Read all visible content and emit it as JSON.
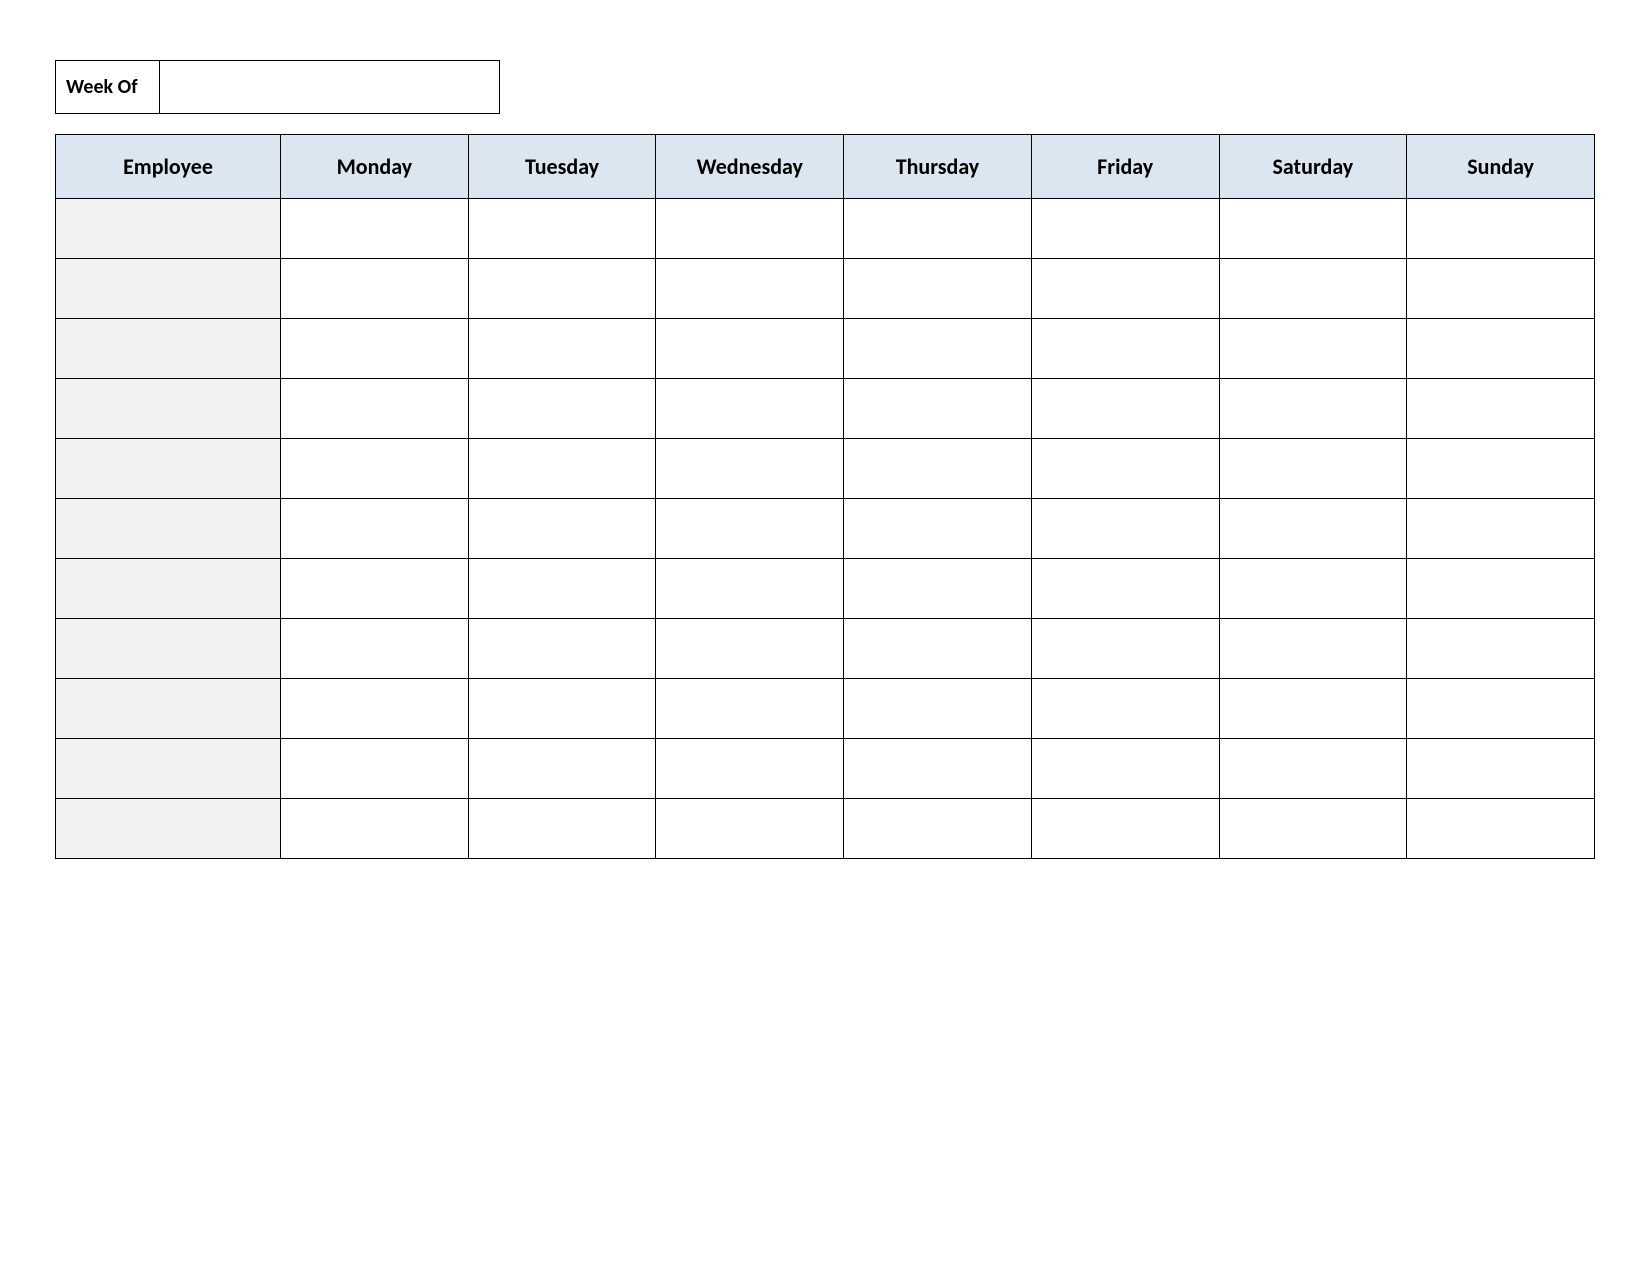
{
  "weekOf": {
    "label": "Week Of",
    "value": ""
  },
  "table": {
    "headers": [
      "Employee",
      "Monday",
      "Tuesday",
      "Wednesday",
      "Thursday",
      "Friday",
      "Saturday",
      "Sunday"
    ],
    "rows": [
      {
        "employee": "",
        "monday": "",
        "tuesday": "",
        "wednesday": "",
        "thursday": "",
        "friday": "",
        "saturday": "",
        "sunday": ""
      },
      {
        "employee": "",
        "monday": "",
        "tuesday": "",
        "wednesday": "",
        "thursday": "",
        "friday": "",
        "saturday": "",
        "sunday": ""
      },
      {
        "employee": "",
        "monday": "",
        "tuesday": "",
        "wednesday": "",
        "thursday": "",
        "friday": "",
        "saturday": "",
        "sunday": ""
      },
      {
        "employee": "",
        "monday": "",
        "tuesday": "",
        "wednesday": "",
        "thursday": "",
        "friday": "",
        "saturday": "",
        "sunday": ""
      },
      {
        "employee": "",
        "monday": "",
        "tuesday": "",
        "wednesday": "",
        "thursday": "",
        "friday": "",
        "saturday": "",
        "sunday": ""
      },
      {
        "employee": "",
        "monday": "",
        "tuesday": "",
        "wednesday": "",
        "thursday": "",
        "friday": "",
        "saturday": "",
        "sunday": ""
      },
      {
        "employee": "",
        "monday": "",
        "tuesday": "",
        "wednesday": "",
        "thursday": "",
        "friday": "",
        "saturday": "",
        "sunday": ""
      },
      {
        "employee": "",
        "monday": "",
        "tuesday": "",
        "wednesday": "",
        "thursday": "",
        "friday": "",
        "saturday": "",
        "sunday": ""
      },
      {
        "employee": "",
        "monday": "",
        "tuesday": "",
        "wednesday": "",
        "thursday": "",
        "friday": "",
        "saturday": "",
        "sunday": ""
      },
      {
        "employee": "",
        "monday": "",
        "tuesday": "",
        "wednesday": "",
        "thursday": "",
        "friday": "",
        "saturday": "",
        "sunday": ""
      },
      {
        "employee": "",
        "monday": "",
        "tuesday": "",
        "wednesday": "",
        "thursday": "",
        "friday": "",
        "saturday": "",
        "sunday": ""
      }
    ]
  }
}
